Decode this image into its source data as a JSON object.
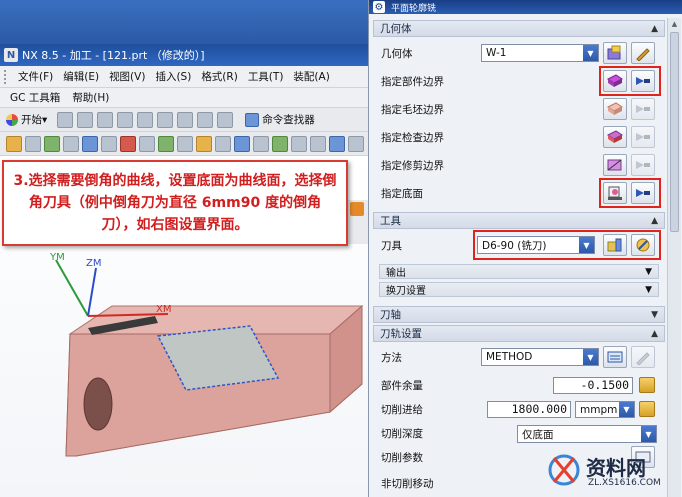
{
  "nx_window": {
    "title": "NX 8.5 - 加工 - [121.prt （修改的）]",
    "menu": [
      "文件(F)",
      "编辑(E)",
      "视图(V)",
      "插入(S)",
      "格式(R)",
      "工具(T)",
      "装配(A)"
    ],
    "menu2": [
      "GC 工具箱",
      "帮助(H)"
    ],
    "start_label": "开始▾",
    "finder_label": "命令查找器"
  },
  "annotation": {
    "text": "3.选择需要倒角的曲线，设置底面为曲线面，选择倒角刀具（例中倒角刀为直径 6mm90 度的倒角刀），如右图设置界面。"
  },
  "axes": {
    "ym": "YM",
    "zm": "ZM",
    "xm": "XM"
  },
  "dialog": {
    "title": "平面轮廓铣",
    "geometry": {
      "header": "几何体",
      "geometry_label": "几何体",
      "geometry_value": "W-1",
      "part_boundary_label": "指定部件边界",
      "blank_boundary_label": "指定毛坯边界",
      "check_boundary_label": "指定检查边界",
      "trim_boundary_label": "指定修剪边界",
      "floor_label": "指定底面"
    },
    "tool": {
      "header": "工具",
      "tool_label": "刀具",
      "tool_value": "D6-90 (铣刀)",
      "output_label": "输出",
      "tool_change_label": "换刀设置"
    },
    "axis": {
      "header": "刀轴"
    },
    "path": {
      "header": "刀轨设置",
      "method_label": "方法",
      "method_value": "METHOD",
      "stock_label": "部件余量",
      "stock_value": "-0.1500",
      "feed_label": "切削进给",
      "feed_value": "1800.000",
      "feed_unit": "mmpm",
      "depth_label": "切削深度",
      "depth_value": "仅底面",
      "params_label": "切削参数",
      "noncut_label": "非切削移动"
    }
  },
  "watermark": {
    "text": "资料网",
    "url": "ZL.XS1616.COM"
  },
  "colors": {
    "highlight": "#e0241c",
    "callout_text": "#d11e1e",
    "part_body": "#e3a8a2"
  }
}
